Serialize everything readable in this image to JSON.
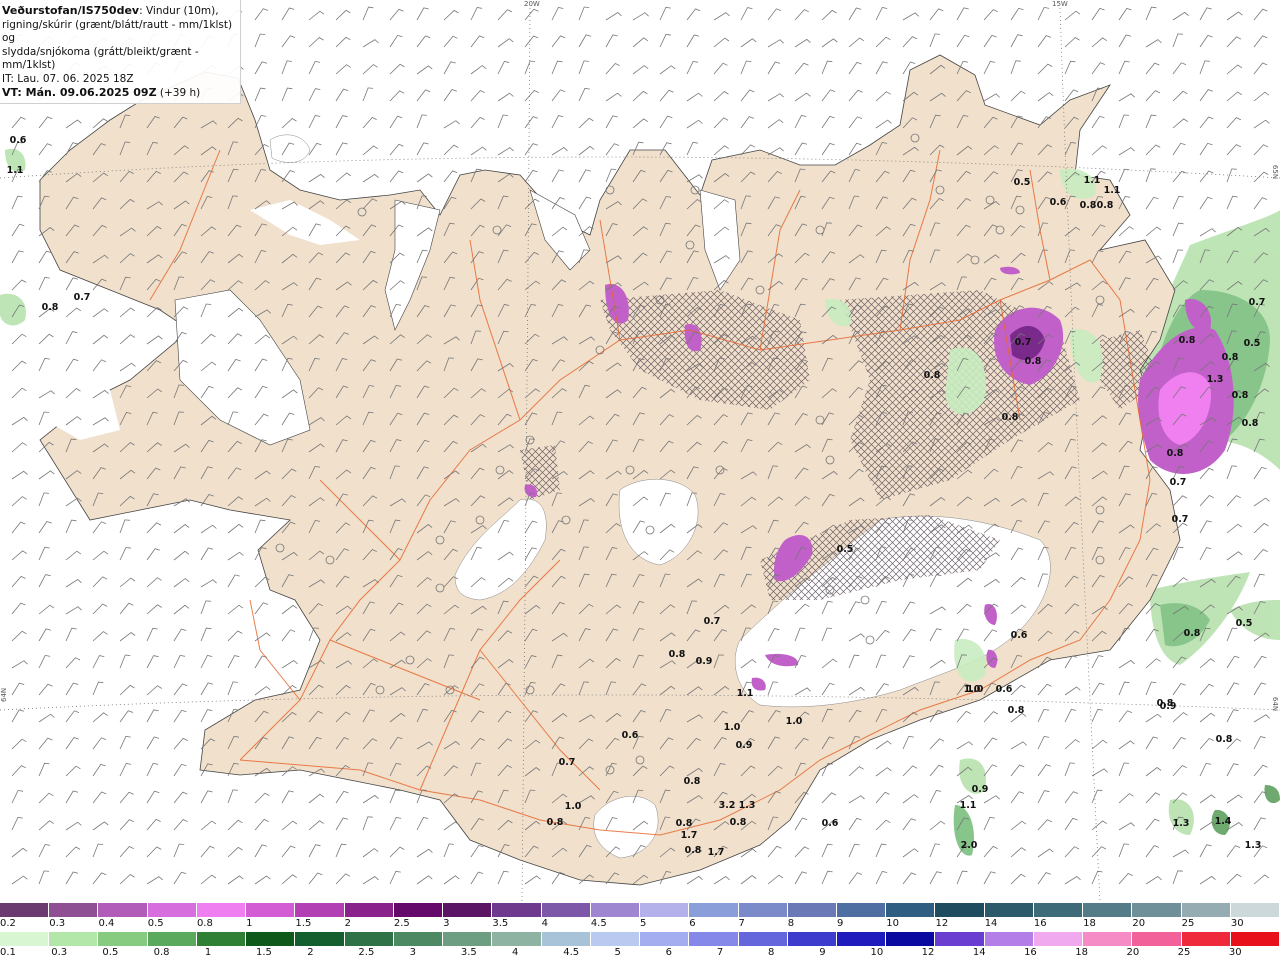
{
  "header": {
    "source": "Veðurstofan/IS750dev",
    "desc_1": ": Vindur (10m),",
    "desc_2": "rigning/skúrir (grænt/blátt/rautt - mm/1klst) og",
    "desc_3": "slydda/snjókoma (grátt/bleikt/grænt - mm/1klst)",
    "issue_time": "IT: Lau. 07. 06. 2025 18Z",
    "valid_label": "VT: Mán. 09.06.2025 09Z",
    "lead": "(+39 h)"
  },
  "graticule": {
    "lon_top": [
      "20W",
      "15W"
    ],
    "lat_left": "64N",
    "lat_right_top": "65N",
    "lat_right_bottom": "64N"
  },
  "colors": {
    "land": "#f0e0cc",
    "glacier": "#ffffff",
    "roads": "#e8672e",
    "rain_light": "#c8ecc0",
    "rain_mid": "#7cc07e",
    "snow_purple": "#c060c8",
    "snow_dark": "#7a2a8a"
  },
  "map_values": [
    "0.6",
    "1.1",
    "0.7",
    "0.8",
    "0.5",
    "1.1",
    "1.1",
    "0.6",
    "0.8",
    "0.8",
    "0.7",
    "0.5",
    "0.7",
    "0.8",
    "0.7",
    "0.5",
    "0.6",
    "0.8",
    "0.9",
    "0.8",
    "0.5",
    "0.8",
    "0.8",
    "1.0",
    "0.6",
    "0.8",
    "1.0",
    "1.0",
    "0.6",
    "0.7",
    "0.8",
    "1.1",
    "1.0",
    "0.8",
    "1.7",
    "0.8",
    "1.7",
    "0.6",
    "1.1",
    "0.9",
    "2.0",
    "1.3",
    "1.4",
    "1.3",
    "3.2",
    "1.3",
    "0.9",
    "1.3",
    "0.9",
    "0.8",
    "0.7",
    "1.0",
    "0.8",
    "0.8",
    "0.8",
    "0.8",
    "0.8",
    "0.8",
    "0.7",
    "0.8",
    "0.8"
  ],
  "legend": {
    "snow_labels": [
      "0.2",
      "0.3",
      "0.4",
      "0.5",
      "0.8",
      "1",
      "1.5",
      "2",
      "2.5",
      "3",
      "3.5",
      "4",
      "4.5",
      "5",
      "6",
      "7",
      "8",
      "9",
      "10",
      "12",
      "14",
      "16",
      "18",
      "20",
      "25",
      "30"
    ],
    "snow_colors": [
      "#6b3a6e",
      "#8e4f93",
      "#b05cb8",
      "#d66fdd",
      "#ef7ff0",
      "#d35bd4",
      "#b23fb4",
      "#8a228c",
      "#650a6a",
      "#5a1665",
      "#6e3a8e",
      "#7e58a8",
      "#9f86d1",
      "#b3b0ea",
      "#8a9ed9",
      "#7b8bc9",
      "#6b7ab6",
      "#4f6fa3",
      "#2e5f83",
      "#1f4c5f",
      "#2d5a6b",
      "#3e6b78",
      "#537c88",
      "#6f8f99",
      "#96acb3",
      "#cdd8da"
    ],
    "rain_labels": [
      "0.1",
      "0.3",
      "0.5",
      "0.8",
      "1",
      "1.5",
      "2",
      "2.5",
      "3",
      "3.5",
      "4",
      "4.5",
      "5",
      "6",
      "7",
      "8",
      "9",
      "10",
      "12",
      "14",
      "16",
      "18",
      "20",
      "25",
      "30"
    ],
    "rain_colors": [
      "#d9f6d2",
      "#b3e7aa",
      "#86cb80",
      "#5aa95d",
      "#2f7f35",
      "#0f5a1a",
      "#155e2d",
      "#2f7248",
      "#4d8a63",
      "#6e9e82",
      "#8fb3a2",
      "#a8c2d8",
      "#b9c9f0",
      "#a3adf0",
      "#8588e8",
      "#6565dc",
      "#3d3ccc",
      "#1f1bbd",
      "#0a0aa0",
      "#6a3ed0",
      "#b37ee8",
      "#f0a8ee",
      "#f58cc6",
      "#f2619a",
      "#ef2a3c",
      "#e8101a"
    ]
  }
}
